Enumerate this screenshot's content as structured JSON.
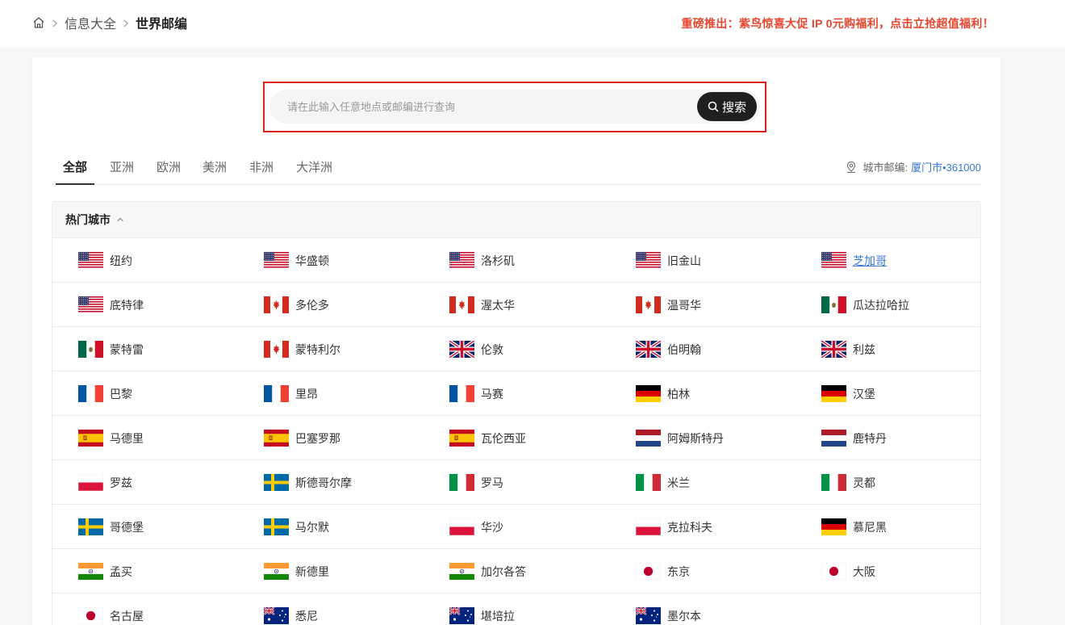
{
  "breadcrumb": {
    "items": [
      "信息大全"
    ],
    "current": "世界邮编"
  },
  "promo": {
    "text": "重磅推出：紫鸟惊喜大促 IP 0元购福利，点击立抢超值福利！",
    "color": "#e8462f"
  },
  "search": {
    "placeholder": "请在此输入任意地点或邮编进行查询",
    "button_label": "搜索"
  },
  "tabs": [
    {
      "label": "全部",
      "active": true
    },
    {
      "label": "亚洲"
    },
    {
      "label": "欧洲"
    },
    {
      "label": "美洲"
    },
    {
      "label": "非洲"
    },
    {
      "label": "大洋洲"
    }
  ],
  "city_postcode": {
    "label": "城市邮编:",
    "value": "厦门市•361000"
  },
  "hot_cities": {
    "title": "热门城市",
    "rows": [
      [
        {
          "name": "纽约",
          "flag": "us"
        },
        {
          "name": "华盛顿",
          "flag": "us"
        },
        {
          "name": "洛杉矶",
          "flag": "us"
        },
        {
          "name": "旧金山",
          "flag": "us"
        },
        {
          "name": "芝加哥",
          "flag": "us",
          "hovered": true
        }
      ],
      [
        {
          "name": "底特律",
          "flag": "us"
        },
        {
          "name": "多伦多",
          "flag": "ca"
        },
        {
          "name": "渥太华",
          "flag": "ca"
        },
        {
          "name": "温哥华",
          "flag": "ca"
        },
        {
          "name": "瓜达拉哈拉",
          "flag": "mx"
        }
      ],
      [
        {
          "name": "蒙特雷",
          "flag": "mx"
        },
        {
          "name": "蒙特利尔",
          "flag": "ca"
        },
        {
          "name": "伦敦",
          "flag": "gb"
        },
        {
          "name": "伯明翰",
          "flag": "gb"
        },
        {
          "name": "利兹",
          "flag": "gb"
        }
      ],
      [
        {
          "name": "巴黎",
          "flag": "fr"
        },
        {
          "name": "里昂",
          "flag": "fr"
        },
        {
          "name": "马赛",
          "flag": "fr"
        },
        {
          "name": "柏林",
          "flag": "de"
        },
        {
          "name": "汉堡",
          "flag": "de"
        }
      ],
      [
        {
          "name": "马德里",
          "flag": "es"
        },
        {
          "name": "巴塞罗那",
          "flag": "es"
        },
        {
          "name": "瓦伦西亚",
          "flag": "es"
        },
        {
          "name": "阿姆斯特丹",
          "flag": "nl"
        },
        {
          "name": "鹿特丹",
          "flag": "nl"
        }
      ],
      [
        {
          "name": "罗兹",
          "flag": "pl"
        },
        {
          "name": "斯德哥尔摩",
          "flag": "se"
        },
        {
          "name": "罗马",
          "flag": "it"
        },
        {
          "name": "米兰",
          "flag": "it"
        },
        {
          "name": "灵都",
          "flag": "it"
        }
      ],
      [
        {
          "name": "哥德堡",
          "flag": "se"
        },
        {
          "name": "马尔默",
          "flag": "se"
        },
        {
          "name": "华沙",
          "flag": "pl"
        },
        {
          "name": "克拉科夫",
          "flag": "pl"
        },
        {
          "name": "慕尼黑",
          "flag": "de"
        }
      ],
      [
        {
          "name": "孟买",
          "flag": "in"
        },
        {
          "name": "新德里",
          "flag": "in"
        },
        {
          "name": "加尔各答",
          "flag": "in"
        },
        {
          "name": "东京",
          "flag": "jp"
        },
        {
          "name": "大阪",
          "flag": "jp"
        }
      ],
      [
        {
          "name": "名古屋",
          "flag": "jp"
        },
        {
          "name": "悉尼",
          "flag": "au"
        },
        {
          "name": "堪培拉",
          "flag": "au"
        },
        {
          "name": "墨尔本",
          "flag": "au"
        }
      ]
    ]
  },
  "colors": {
    "accent_link": "#3a78d6",
    "promo": "#e8462f",
    "search_frame": "#e0201a"
  }
}
